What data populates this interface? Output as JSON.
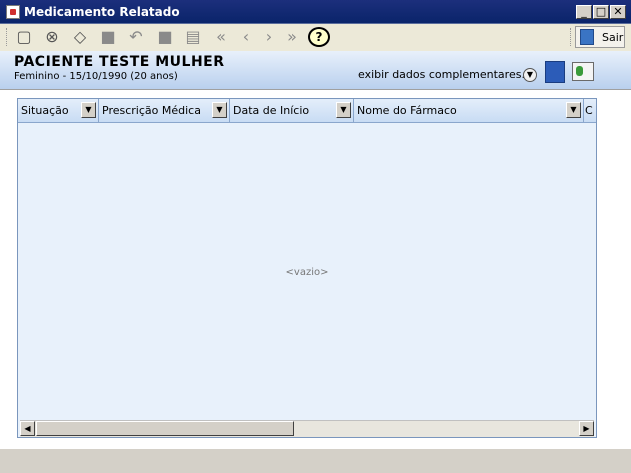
{
  "window": {
    "title": "Medicamento Relatado"
  },
  "toolbar": {
    "exit_label": "Sair",
    "help_glyph": "?"
  },
  "patient": {
    "name": "PACIENTE TESTE MULHER",
    "info": "Feminino - 15/10/1990 (20 anos)",
    "extra_label": "exibir dados complementares..."
  },
  "grid": {
    "columns": [
      "Situação",
      "Prescrição Médica",
      "Data de Início",
      "Nome do Fármaco",
      "C"
    ],
    "empty_text": "<vazio>"
  },
  "colors": {
    "header_blue": "#b9d0ee",
    "title_blue": "#0a246a",
    "grid_bg": "#e8f1fb"
  }
}
